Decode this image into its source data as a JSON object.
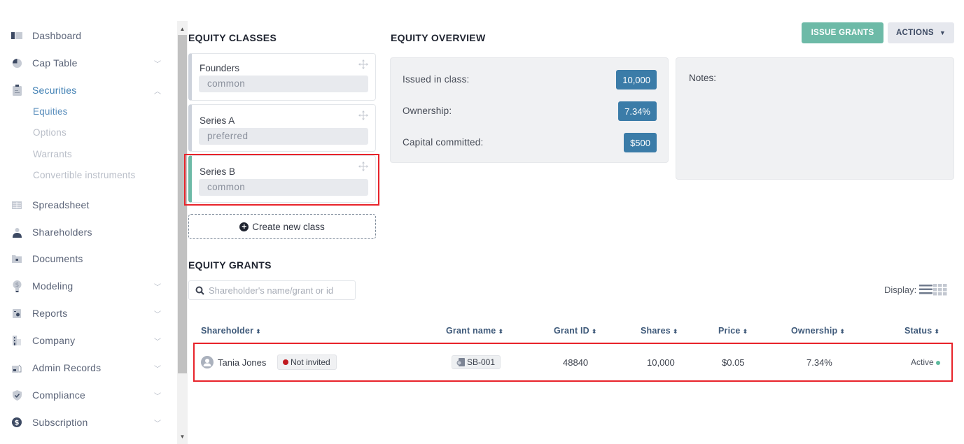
{
  "sidebar": {
    "items": [
      {
        "label": "Dashboard",
        "icon": "dashboard-icon"
      },
      {
        "label": "Cap Table",
        "icon": "pie-chart-icon",
        "chevron": "down"
      },
      {
        "label": "Securities",
        "icon": "clipboard-icon",
        "chevron": "up",
        "active": true
      },
      {
        "label": "Spreadsheet",
        "icon": "table-icon"
      },
      {
        "label": "Shareholders",
        "icon": "user-icon"
      },
      {
        "label": "Documents",
        "icon": "locked-folder-icon"
      },
      {
        "label": "Modeling",
        "icon": "lightbulb-dollar-icon",
        "chevron": "down"
      },
      {
        "label": "Reports",
        "icon": "report-icon",
        "chevron": "down"
      },
      {
        "label": "Company",
        "icon": "building-icon",
        "chevron": "down"
      },
      {
        "label": "Admin Records",
        "icon": "admin-records-icon",
        "chevron": "down"
      },
      {
        "label": "Compliance",
        "icon": "shield-check-icon",
        "chevron": "down"
      },
      {
        "label": "Subscription",
        "icon": "dollar-circle-icon",
        "chevron": "down"
      }
    ],
    "securities_sub": [
      {
        "label": "Equities",
        "active": true
      },
      {
        "label": "Options"
      },
      {
        "label": "Warrants"
      },
      {
        "label": "Convertible instruments"
      }
    ],
    "chevron_down": "﹀",
    "chevron_up": "︿"
  },
  "equity_classes": {
    "title": "EQUITY CLASSES",
    "classes": [
      {
        "name": "Founders",
        "type": "common"
      },
      {
        "name": "Series A",
        "type": "preferred"
      },
      {
        "name": "Series B",
        "type": "common",
        "selected": true
      }
    ],
    "create_label": "Create new class"
  },
  "overview": {
    "title": "EQUITY OVERVIEW",
    "rows": [
      {
        "label": "Issued in class:",
        "value": "10,000"
      },
      {
        "label": "Ownership:",
        "value": "7.34%"
      },
      {
        "label": "Capital committed:",
        "value": "$500"
      }
    ],
    "notes_label": "Notes:"
  },
  "toolbar": {
    "issue_grants": "ISSUE GRANTS",
    "actions": "ACTIONS",
    "actions_caret": "▼"
  },
  "grants": {
    "title": "EQUITY GRANTS",
    "search_placeholder": "Shareholder's name/grant or id",
    "display_label": "Display:",
    "sort_glyph": "⬍",
    "columns": [
      "Shareholder",
      "Grant name",
      "Grant ID",
      "Shares",
      "Price",
      "Ownership",
      "Status"
    ],
    "rows": [
      {
        "shareholder": "Tania Jones",
        "invite_status": "Not invited",
        "grant_name": "SB-001",
        "grant_id": "48840",
        "shares": "10,000",
        "price": "$0.05",
        "ownership": "7.34%",
        "status": "Active"
      }
    ]
  },
  "colors": {
    "accent_green": "#6dbaa7",
    "badge_blue": "#3b7ca8",
    "active_nav": "#3f7fb3",
    "highlight_red": "#e8232a",
    "not_invited_dot": "#c0181f",
    "active_dot": "#5db99d"
  }
}
